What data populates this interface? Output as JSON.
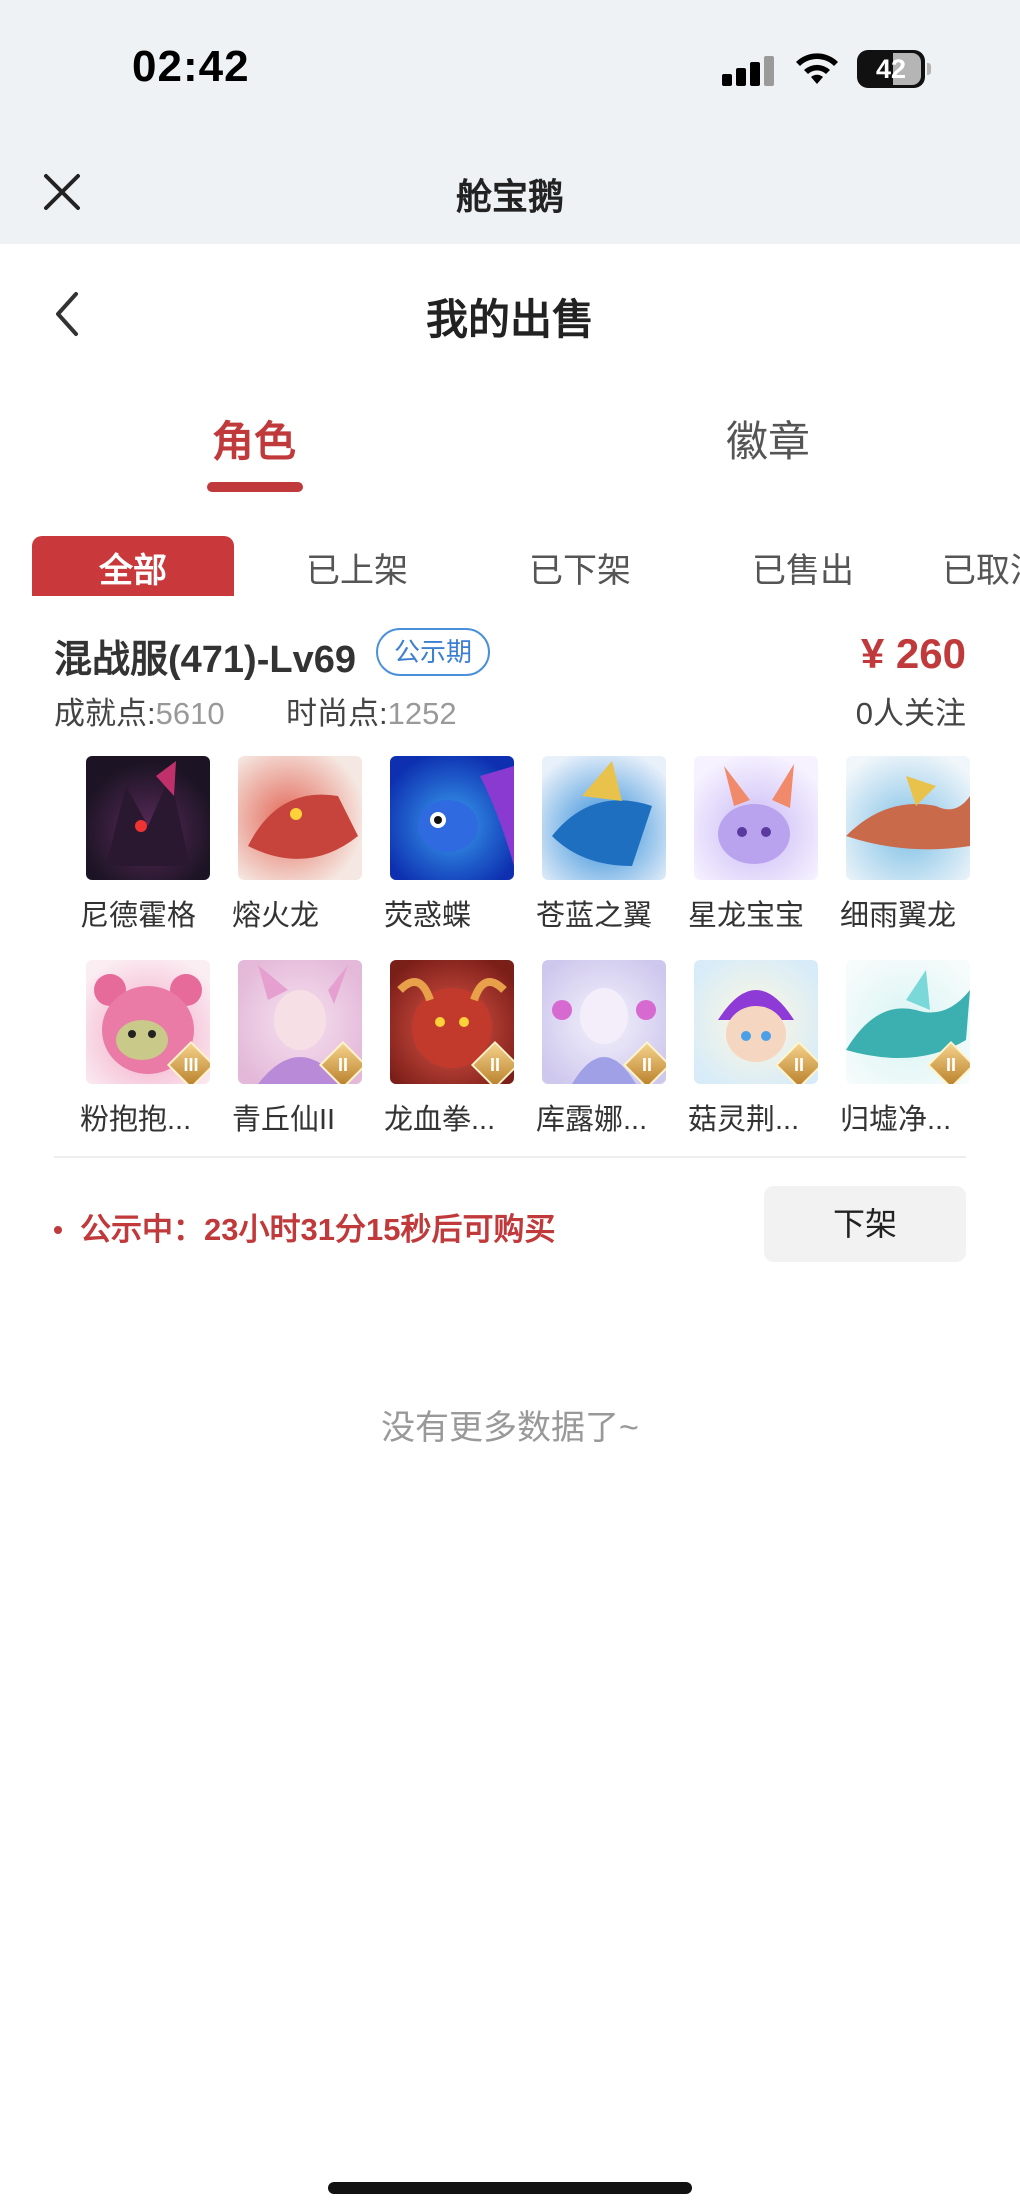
{
  "status_bar": {
    "time": "02:42",
    "battery": "42"
  },
  "app_header": {
    "title": "舱宝鹅"
  },
  "nav": {
    "title": "我的出售"
  },
  "main_tabs": [
    {
      "label": "角色",
      "active": true
    },
    {
      "label": "徽章",
      "active": false
    }
  ],
  "filter_tabs": [
    {
      "label": "全部",
      "active": true
    },
    {
      "label": "已上架",
      "active": false
    },
    {
      "label": "已下架",
      "active": false
    },
    {
      "label": "已售出",
      "active": false
    },
    {
      "label": "已取消",
      "active": false
    }
  ],
  "listing": {
    "server": "混战服(471)-Lv69",
    "badge": "公示期",
    "price": "¥ 260",
    "achievement_label": "成就点:",
    "achievement_value": "5610",
    "fashion_label": "时尚点:",
    "fashion_value": "1252",
    "followers": "0人关注",
    "pets_row1": [
      "尼德霍格",
      "熔火龙",
      "荧惑蝶",
      "苍蓝之翼",
      "星龙宝宝",
      "细雨翼龙"
    ],
    "pets_row2": [
      "粉抱抱...",
      "青丘仙II",
      "龙血拳...",
      "库露娜...",
      "菇灵荆...",
      "归墟净..."
    ],
    "ranks_row2": [
      "III",
      "II",
      "II",
      "II",
      "II",
      "II"
    ],
    "notice": "公示中：23小时31分15秒后可购买",
    "delist_label": "下架"
  },
  "footer": {
    "no_more": "没有更多数据了~"
  },
  "colors": {
    "accent": "#c0393b",
    "badge_blue": "#3d7fd0",
    "header_bg": "#eef2f5"
  }
}
